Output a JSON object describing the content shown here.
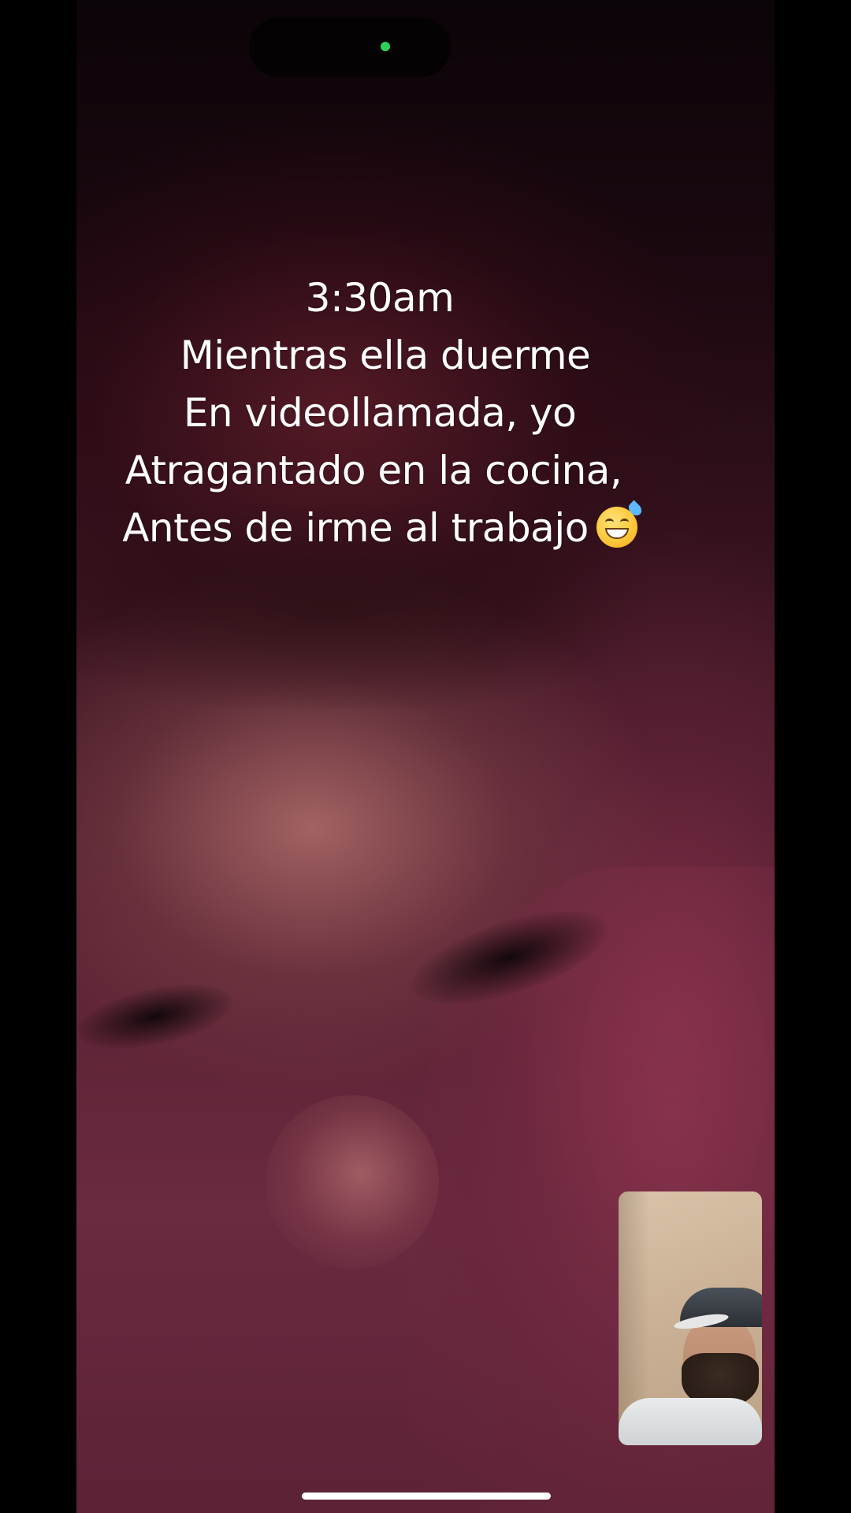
{
  "call": {
    "caption_lines": [
      "3:30am",
      "Mientras ella duerme",
      "En videollamada, yo",
      "Atragantado en la cocina,",
      "Antes de irme al trabajo"
    ],
    "caption_emoji": "grinning-face-with-sweat-icon"
  },
  "indicators": {
    "camera_active_color": "#2fd158"
  }
}
